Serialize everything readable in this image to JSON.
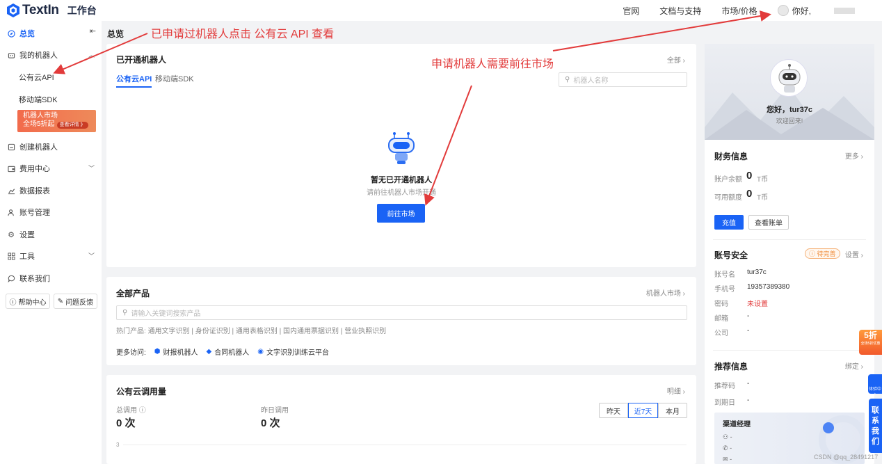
{
  "topbar": {
    "logo_text": "TextIn",
    "workspace": "工作台",
    "nav": [
      "官网",
      "文档与支持",
      "市场/价格"
    ],
    "user_greeting": "你好,"
  },
  "sidebar": {
    "items": [
      {
        "label": "总览",
        "icon": "compass-icon"
      },
      {
        "label": "我的机器人",
        "icon": "robot-icon"
      },
      {
        "label": "公有云API"
      },
      {
        "label": "移动端SDK"
      },
      {
        "label": "创建机器人",
        "icon": "create-icon"
      },
      {
        "label": "费用中心",
        "icon": "wallet-icon"
      },
      {
        "label": "数据报表",
        "icon": "chart-icon"
      },
      {
        "label": "账号管理",
        "icon": "users-icon"
      },
      {
        "label": "设置",
        "icon": "gear-icon"
      },
      {
        "label": "工具",
        "icon": "grid-icon"
      },
      {
        "label": "联系我们",
        "icon": "chat-icon"
      }
    ],
    "promo": {
      "title": "机器人市场",
      "subtitle": "全场5折起",
      "badge": "查看详情 》"
    },
    "help_label": "帮助中心",
    "feedback_label": "问题反馈"
  },
  "page_title": "总览",
  "robots_card": {
    "title": "已开通机器人",
    "link": "全部",
    "tabs": [
      "公有云API",
      "移动端SDK"
    ],
    "search_placeholder": "机器人名称",
    "empty_title": "暂无已开通机器人",
    "empty_sub": "请前往机器人市场开通",
    "button": "前往市场"
  },
  "products_card": {
    "title": "全部产品",
    "link": "机器人市场",
    "search_placeholder": "请输入关键词搜索产品",
    "hot_label": "热门产品:",
    "hot_items": [
      "通用文字识别",
      "身份证识别",
      "通用表格识别",
      "国内通用票据识别",
      "营业执照识别"
    ],
    "more_label": "更多访问:",
    "more_items": [
      "财报机器人",
      "合同机器人",
      "文字识别训练云平台"
    ]
  },
  "usage_card": {
    "title": "公有云调用量",
    "link": "明细",
    "total_label": "总调用",
    "total_value": "0 次",
    "yesterday_label": "昨日调用",
    "yesterday_value": "0 次",
    "ranges": [
      "昨天",
      "近7天",
      "本月"
    ],
    "active_range": "近7天",
    "axis_tick": "3"
  },
  "right_panel": {
    "greeting": "您好，tur37c",
    "welcome": "欢迎回来!",
    "finance": {
      "title": "财务信息",
      "link": "更多",
      "balance_label": "账户余额",
      "balance_value": "0",
      "balance_unit": "T币",
      "credit_label": "可用额度",
      "credit_value": "0",
      "credit_unit": "T币",
      "recharge_button": "充值",
      "bill_button": "查看账单"
    },
    "security": {
      "title": "账号安全",
      "status_badge": "待完善",
      "link": "设置",
      "rows": [
        {
          "label": "账号名",
          "value": "tur37c"
        },
        {
          "label": "手机号",
          "value": "19357389380"
        },
        {
          "label": "密码",
          "value": "未设置"
        },
        {
          "label": "邮箱",
          "value": "-"
        },
        {
          "label": "公司",
          "value": "-"
        }
      ]
    },
    "referral": {
      "title": "推荐信息",
      "link": "绑定",
      "rows": [
        {
          "label": "推荐码",
          "value": "-"
        },
        {
          "label": "到期日",
          "value": "-"
        }
      ]
    },
    "manager": {
      "title": "渠道经理",
      "rows": [
        "-",
        "-",
        "-"
      ]
    }
  },
  "float": {
    "discount": "5折",
    "discount_sub": "全场5折优惠",
    "experience": "体验中心",
    "contact_chars": [
      "联",
      "系",
      "我",
      "们"
    ]
  },
  "annotations": {
    "left": "已申请过机器人点击 公有云 API 查看",
    "center": "申请机器人需要前往市场"
  },
  "watermark": "CSDN @qq_28491217",
  "colors": {
    "accent": "#1a63f5",
    "annotation": "#e23b3b",
    "promo": "#f26b4c",
    "warning": "#f08c3a"
  }
}
